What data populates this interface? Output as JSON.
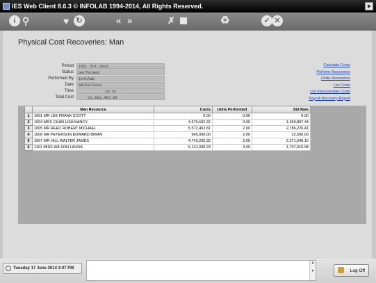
{
  "app": {
    "title": "IES Web Client 8.6.3 © INFOLAB 1994-2014, All Rights Reserved."
  },
  "toolbar": {
    "icons": [
      "info-icon",
      "search-icon",
      "favorite-icon",
      "history-icon",
      "back-icon",
      "forward-icon",
      "tools-icon",
      "stop-icon",
      "recycle-icon",
      "ok-icon",
      "cancel-icon"
    ]
  },
  "page": {
    "title": "Physical Cost Recoveries: Man"
  },
  "fields": [
    {
      "label": "Period",
      "value": "156: Oct 2013"
    },
    {
      "label": "Status",
      "value": "performed"
    },
    {
      "label": "Performed By",
      "value": "Infolab"
    },
    {
      "label": "Date",
      "value": "08/11/2013"
    },
    {
      "label": "Time",
      "value": "14:32"
    },
    {
      "label": "Total Cost",
      "value": "21,061,467.85"
    }
  ],
  "links": [
    "Calculate Costs",
    "Perform Recoveries",
    "Undo Recoveries",
    "List Costs",
    "List Irrecoverable Costs",
    "Payroll Recovery Report"
  ],
  "grid": {
    "columns": [
      "Man Resource",
      "Costs",
      "Units Performed",
      "Std Rate"
    ],
    "rows": [
      {
        "num": "1",
        "resource": "1001 MR LEE FRANK SCOTT",
        "costs": "0.00",
        "units": "0.00",
        "rate": "0.00"
      },
      {
        "num": "2",
        "resource": "1004 MRS CHAN LISA NANCY",
        "costs": "4,679,692.32",
        "units": "3.00",
        "rate": "1,559,897.44"
      },
      {
        "num": "3",
        "resource": "1005 MR REED ROBERT MICHAEL",
        "costs": "5,572,452.81",
        "units": "2.00",
        "rate": "2,786,226.41"
      },
      {
        "num": "4",
        "resource": "1006 MR PETERSON EDWARD BRIAN",
        "costs": "945,000.00",
        "units": "2.00",
        "rate": "22,500.00"
      },
      {
        "num": "5",
        "resource": "1007 MR HILL WALTER JAMES",
        "costs": "4,743,292.32",
        "units": "2.00",
        "rate": "2,371,646.16"
      },
      {
        "num": "6",
        "resource": "1101 MISS WILSON LAURA",
        "costs": "5,121,030.23",
        "units": "3.00",
        "rate": "1,707,010.08"
      }
    ]
  },
  "status": {
    "datetime": "Tuesday 17 June 2014 3:07 PM",
    "logoff": "Log Off"
  }
}
